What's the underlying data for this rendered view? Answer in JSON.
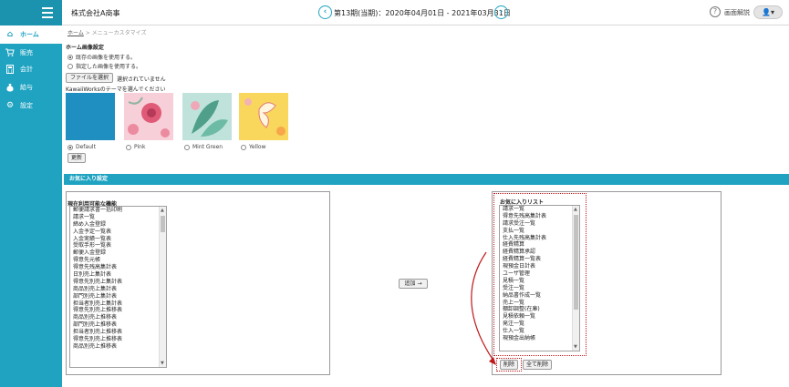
{
  "header": {
    "company": "株式会社A商事",
    "period": "第13期(当期)：2020年04月01日 - 2021年03月31日",
    "help": "画面解説",
    "user_glyph": "👤▾",
    "prev_glyph": "‹",
    "next_glyph": "›"
  },
  "sidebar": {
    "items": [
      {
        "label": "ホーム",
        "icon": "home-icon",
        "glyph": "⌂"
      },
      {
        "label": "販売",
        "icon": "cart-icon",
        "glyph": "🛒"
      },
      {
        "label": "会計",
        "icon": "calculator-icon",
        "glyph": "▦"
      },
      {
        "label": "給与",
        "icon": "money-bag-icon",
        "glyph": "●"
      },
      {
        "label": "設定",
        "icon": "gear-icon",
        "glyph": "⚙"
      }
    ]
  },
  "breadcrumb": {
    "home": "ホーム",
    "separator": " > ",
    "current": "メニューカスタマイズ"
  },
  "home_image": {
    "title": "ホーム画像設定",
    "option_default": "既存の画像を使用する。",
    "option_custom": "指定した画像を使用する。",
    "file_button": "ファイルを選択",
    "file_status": "選択されていません",
    "theme_prompt": "KawaiiWorksのテーマを選んでください",
    "themes": [
      {
        "name": "Default",
        "color": "#1e8fc0"
      },
      {
        "name": "Pink",
        "color": "#f6cfd8"
      },
      {
        "name": "Mint Green",
        "color": "#bfe3da"
      },
      {
        "name": "Yellow",
        "color": "#f9d65c"
      }
    ],
    "update_button": "更新"
  },
  "favorites": {
    "section_title": "お気に入り設定",
    "available_title": "現在利用可能な機能",
    "available_items": [
      "郵便請求書一括印刷",
      "請求一覧",
      "締め入金登録",
      "入金予定一覧表",
      "入金実績一覧表",
      "受取手形一覧表",
      "郵便入金登録",
      "得意先元帳",
      "得意先残高集計表",
      "日別売上集計表",
      "得意先別売上集計表",
      "商品別売上集計表",
      "部門別売上集計表",
      "担当者別売上集計表",
      "得意先別売上推移表",
      "商品別売上推移表",
      "部門別売上推移表",
      "担当者別売上推移表",
      "得意先別売上推移表",
      "商品別売上推移表"
    ],
    "add_button": "追加 →",
    "favorite_title": "お気に入りリスト",
    "favorite_items": [
      "請求一覧",
      "得意先残高集計表",
      "請求受注一覧",
      "支払一覧",
      "仕入先残高集計表",
      "経費精算",
      "経費精算承認",
      "経費精算一覧表",
      "現預金日計表",
      "ユーザ管理",
      "見積一覧",
      "受注一覧",
      "納品書作成一覧",
      "売上一覧",
      "棚卸調整(在庫)",
      "見積依頼一覧",
      "発注一覧",
      "仕入一覧",
      "現預金出納帳"
    ],
    "delete_button": "削除",
    "delete_all_button": "全て削除"
  },
  "colors": {
    "accent": "#1fa3c1",
    "annotation": "#c0181b"
  }
}
